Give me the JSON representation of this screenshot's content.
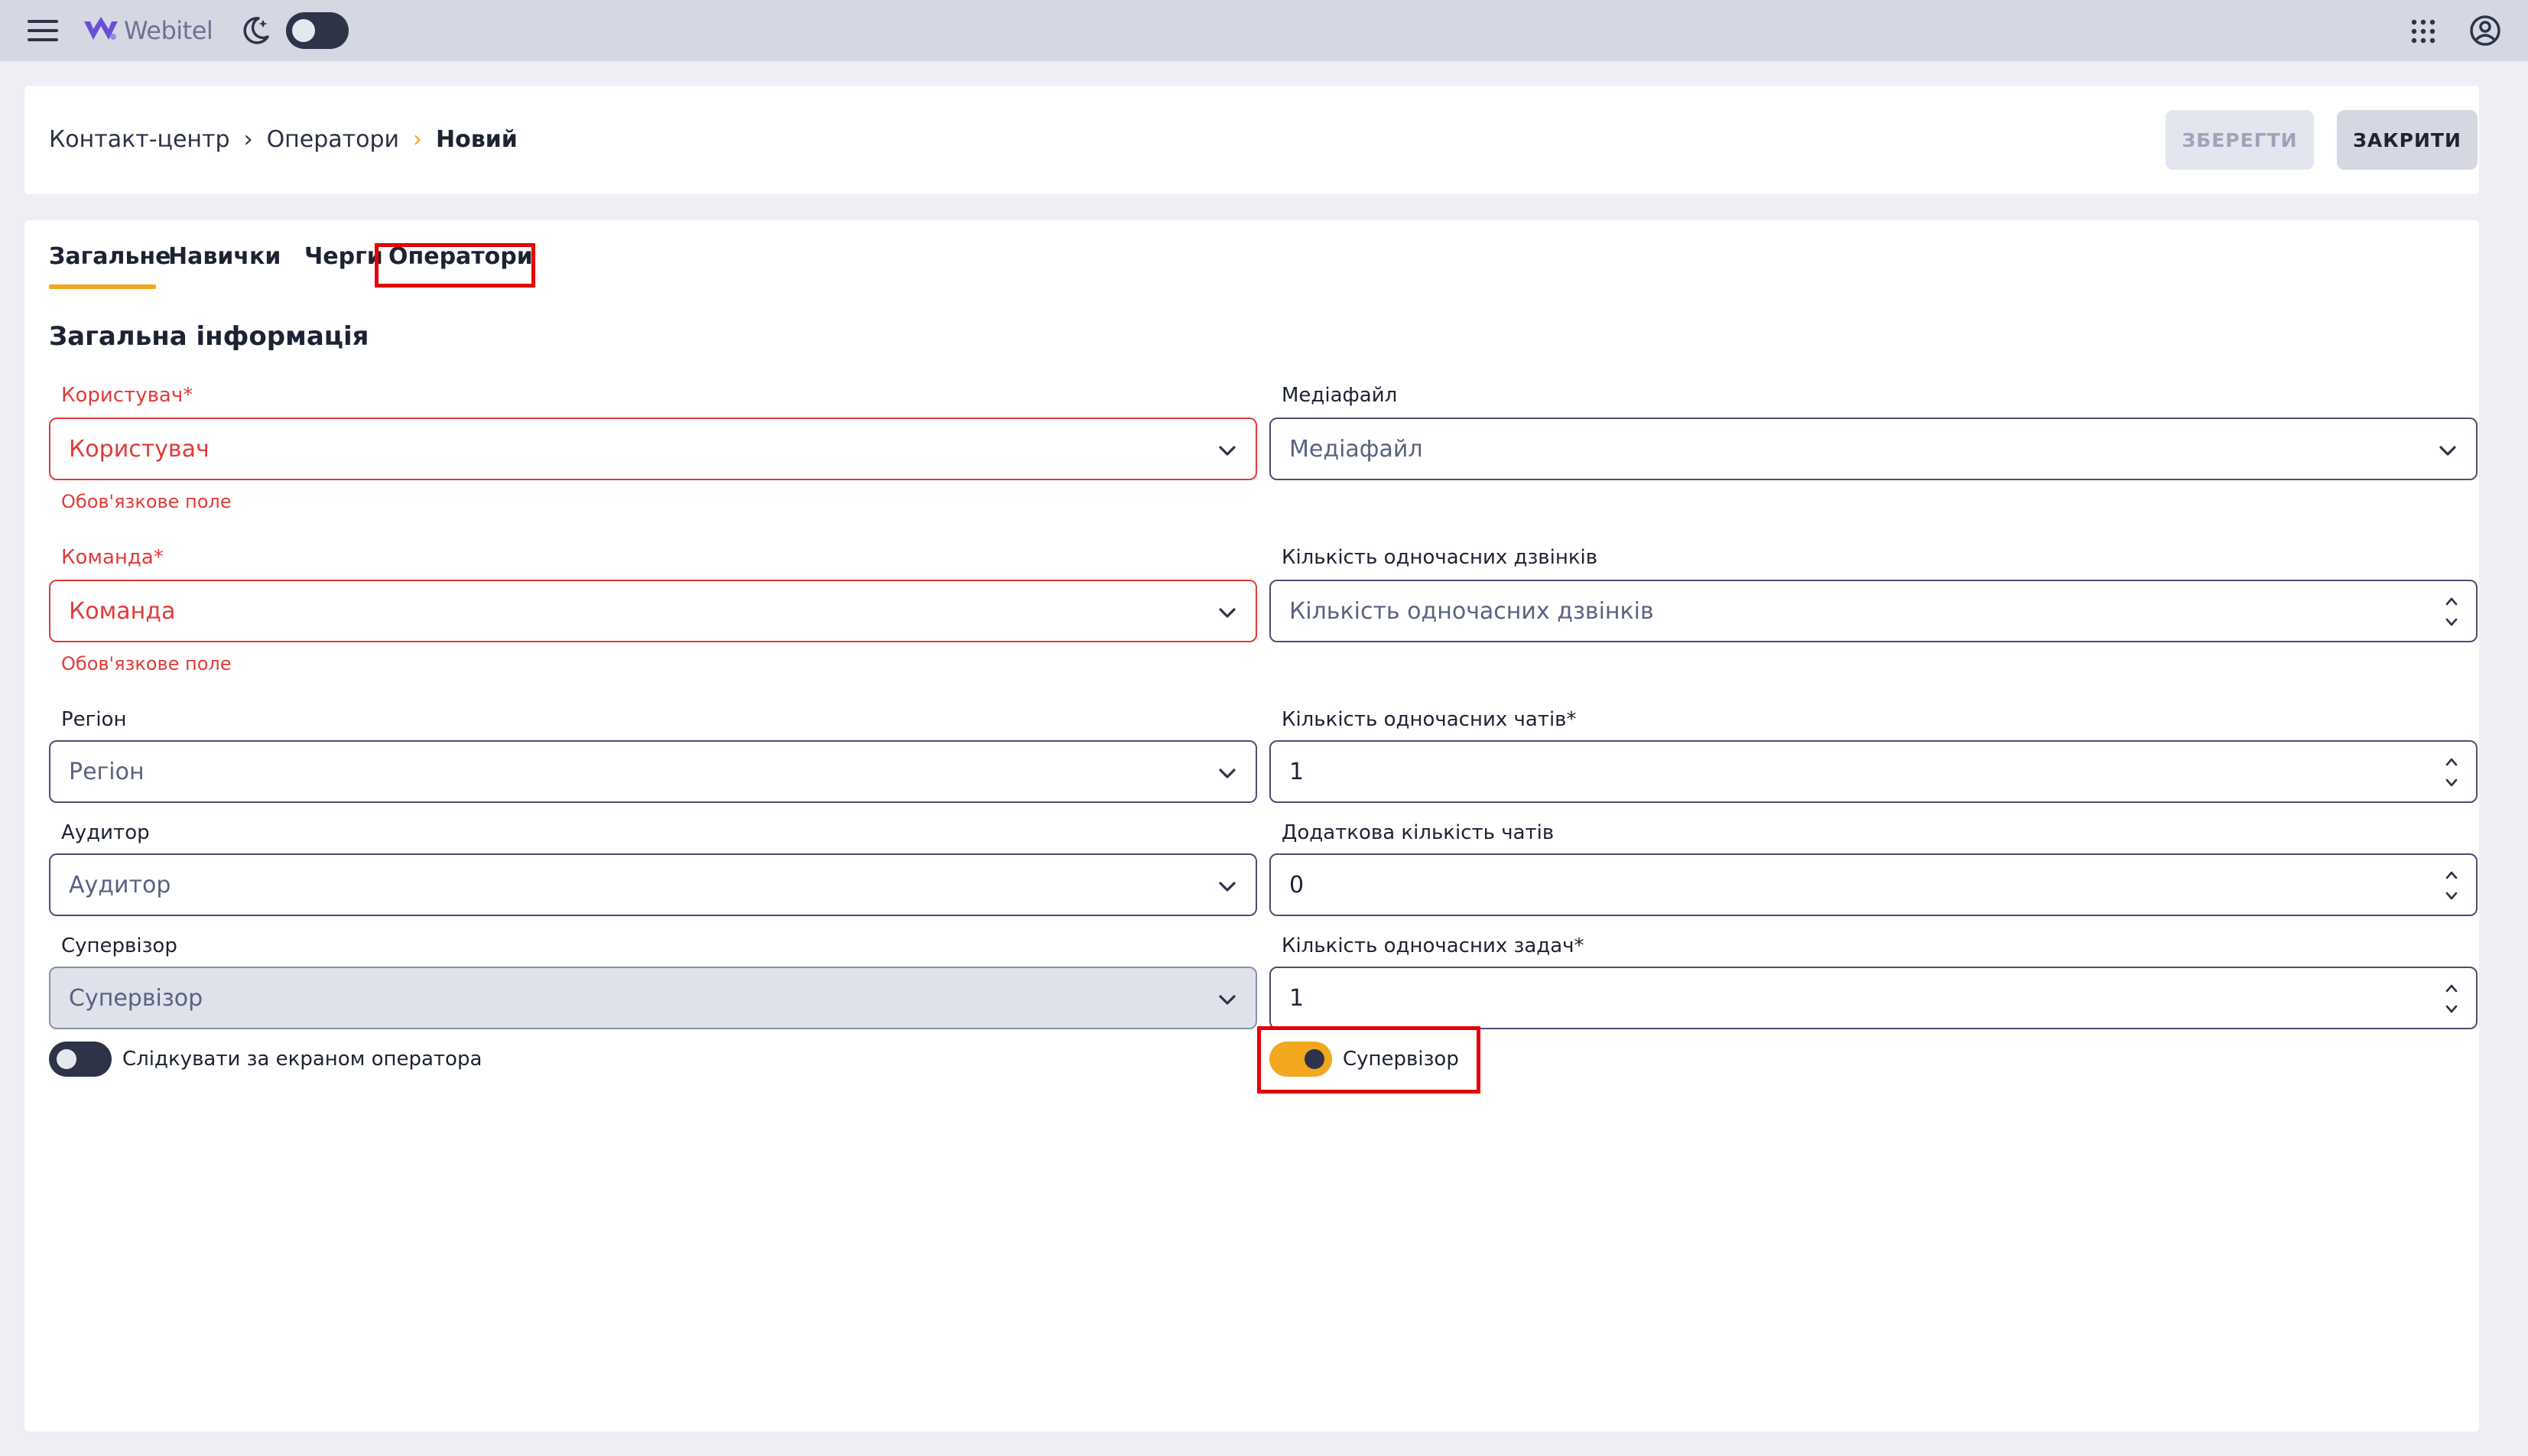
{
  "topbar": {
    "logo_text": "Webitel",
    "icons": [
      "menu-icon",
      "webitel-logo-icon",
      "moon-icon",
      "apps-grid-icon",
      "account-icon"
    ],
    "theme_toggle_on": false
  },
  "breadcrumb": {
    "items": [
      "Контакт-центр",
      "Оператори"
    ],
    "current": "Новий"
  },
  "actions": {
    "save_label": "ЗБЕРЕГТИ",
    "close_label": "ЗАКРИТИ"
  },
  "tabs": {
    "items": [
      "Загальне",
      "Навички",
      "Черги",
      "Оператори"
    ],
    "active": "Загальне"
  },
  "section_title": "Загальна інформація",
  "form": {
    "user": {
      "label": "Користувач*",
      "placeholder": "Користувач",
      "error": "Обов'язкове поле"
    },
    "team": {
      "label": "Команда*",
      "placeholder": "Команда",
      "error": "Обов'язкове поле"
    },
    "region": {
      "label": "Регіон",
      "placeholder": "Регіон"
    },
    "auditor": {
      "label": "Аудитор",
      "placeholder": "Аудитор"
    },
    "supervisor_select": {
      "label": "Супервізор",
      "placeholder": "Супервізор"
    },
    "media": {
      "label": "Медіафайл",
      "placeholder": "Медіафайл"
    },
    "calls": {
      "label": "Кількість одночасних дзвінків",
      "placeholder": "Кількість одночасних дзвінків"
    },
    "chats": {
      "label": "Кількість одночасних чатів*",
      "value": "1"
    },
    "extra_chats": {
      "label": "Додаткова кількість чатів",
      "value": "0"
    },
    "tasks": {
      "label": "Кількість одночасних задач*",
      "value": "1"
    },
    "follow_screen": {
      "label": "Слідкувати за екраном оператора",
      "on": false
    },
    "is_supervisor": {
      "label": "Супервізор",
      "on": true
    }
  },
  "colors": {
    "accent": "#f1a81e",
    "error": "#e23a3a",
    "highlight": "#e6000a",
    "dark": "#2d3447"
  }
}
